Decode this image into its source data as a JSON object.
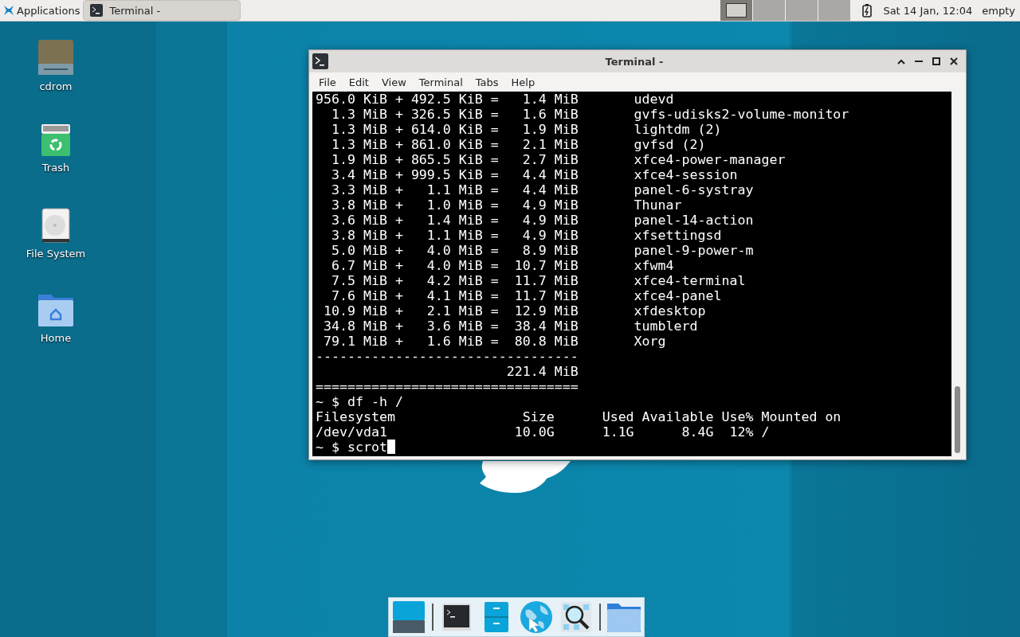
{
  "panel": {
    "applications": "Applications",
    "tasks": [
      {
        "title": "Terminal -",
        "selected": true
      }
    ],
    "workspaces": [
      {
        "selected": true
      },
      {
        "selected": false
      },
      {
        "selected": false
      },
      {
        "selected": false
      }
    ],
    "clock": "Sat 14 Jan, 12:04",
    "user": "empty"
  },
  "desktop_icons": [
    {
      "label": "cdrom",
      "kind": "cdrom"
    },
    {
      "label": "Trash",
      "kind": "trash"
    },
    {
      "label": "File System",
      "kind": "drive"
    },
    {
      "label": "Home",
      "kind": "home"
    }
  ],
  "window": {
    "title": "Terminal -",
    "menu": [
      "File",
      "Edit",
      "View",
      "Terminal",
      "Tabs",
      "Help"
    ],
    "lines": [
      "956.0 KiB + 492.5 KiB =   1.4 MiB       udevd",
      "  1.3 MiB + 326.5 KiB =   1.6 MiB       gvfs-udisks2-volume-monitor",
      "  1.3 MiB + 614.0 KiB =   1.9 MiB       lightdm (2)",
      "  1.3 MiB + 861.0 KiB =   2.1 MiB       gvfsd (2)",
      "  1.9 MiB + 865.5 KiB =   2.7 MiB       xfce4-power-manager",
      "  3.4 MiB + 999.5 KiB =   4.4 MiB       xfce4-session",
      "  3.3 MiB +   1.1 MiB =   4.4 MiB       panel-6-systray",
      "  3.8 MiB +   1.0 MiB =   4.9 MiB       Thunar",
      "  3.6 MiB +   1.4 MiB =   4.9 MiB       panel-14-action",
      "  3.8 MiB +   1.1 MiB =   4.9 MiB       xfsettingsd",
      "  5.0 MiB +   4.0 MiB =   8.9 MiB       panel-9-power-m",
      "  6.7 MiB +   4.0 MiB =  10.7 MiB       xfwm4",
      "  7.5 MiB +   4.2 MiB =  11.7 MiB       xfce4-terminal",
      "  7.6 MiB +   4.1 MiB =  11.7 MiB       xfce4-panel",
      " 10.9 MiB +   2.1 MiB =  12.9 MiB       xfdesktop",
      " 34.8 MiB +   3.6 MiB =  38.4 MiB       tumblerd",
      " 79.1 MiB +   1.6 MiB =  80.8 MiB       Xorg",
      "---------------------------------",
      "                        221.4 MiB",
      "=================================",
      "~ $ df -h /",
      "Filesystem                Size      Used Available Use% Mounted on",
      "/dev/vda1                10.0G      1.1G      8.4G  12% /",
      "~ $ scrot"
    ],
    "cursor_visible": true
  }
}
